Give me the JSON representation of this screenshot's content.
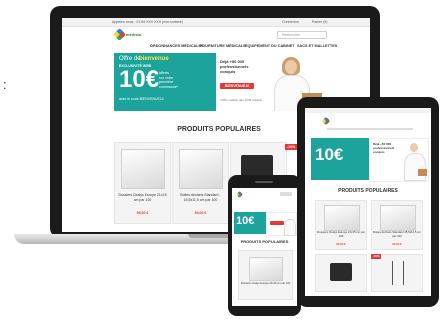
{
  "side_mark": ":",
  "brand": {
    "name": "médisia"
  },
  "desktop": {
    "topbar": {
      "left": "Appelez-nous : 01 84 XXX XXX (non-surtaxé)",
      "account": "Connexion",
      "cart": "Panier (0)"
    },
    "search_placeholder": "Rechercher",
    "nav": [
      "ORDONNANCES MÉDICALES",
      "FOURNITURE MÉDICALE",
      "ÉQUIPEMENT DU CABINET",
      "SACS ET MALLETTES"
    ],
    "banner": {
      "kicker": "Offre de",
      "kicker_strong": "bienvenue",
      "sub": "EXCLUSIVITÉ WEB",
      "amount": "10€",
      "offer_lines": [
        "offerts",
        "sur votre",
        "première",
        "commande*"
      ],
      "code_line": "avec le code BIENVENUE10",
      "panel_title": "Déjà +50 000 professionnels conquis",
      "cta": "BIENVENUE10",
      "footnote": "*Offre valable dès 100€ d'achat"
    },
    "section_title": "PRODUITS POPULAIRES",
    "products": [
      {
        "name": "Dossiers Oxalys Europe 21x15 cm par 100",
        "price": "95,00 €"
      },
      {
        "name": "Boites déchets Standard - 15,5x11,5 cm par 100",
        "price": "95,00 €"
      },
      {
        "name": "",
        "price": ""
      }
    ],
    "badge": "-10%"
  },
  "tablet": {
    "section_title": "PRODUITS POPULAIRES",
    "amount": "10€",
    "panel_title": "Déjà +50 000 professionnels conquis",
    "products": [
      {
        "name": "Dossiers Oxalys Europe 21x15 cm par 100",
        "price": "95,00 €"
      },
      {
        "name": "Boites déchets Standard 15,5x11,5 cm par 100",
        "price": "95,00 €"
      }
    ],
    "badge": "-10%"
  },
  "phone": {
    "amount": "10€",
    "section_title": "PRODUITS POPULAIRES",
    "products": [
      {
        "name": "Dossiers Oxalys Europe 21x15 cm par 100",
        "price": "95,00 €"
      }
    ]
  },
  "colors": {
    "teal": "#1ba39c",
    "red": "#e53935",
    "device": "#1a1a1a"
  }
}
